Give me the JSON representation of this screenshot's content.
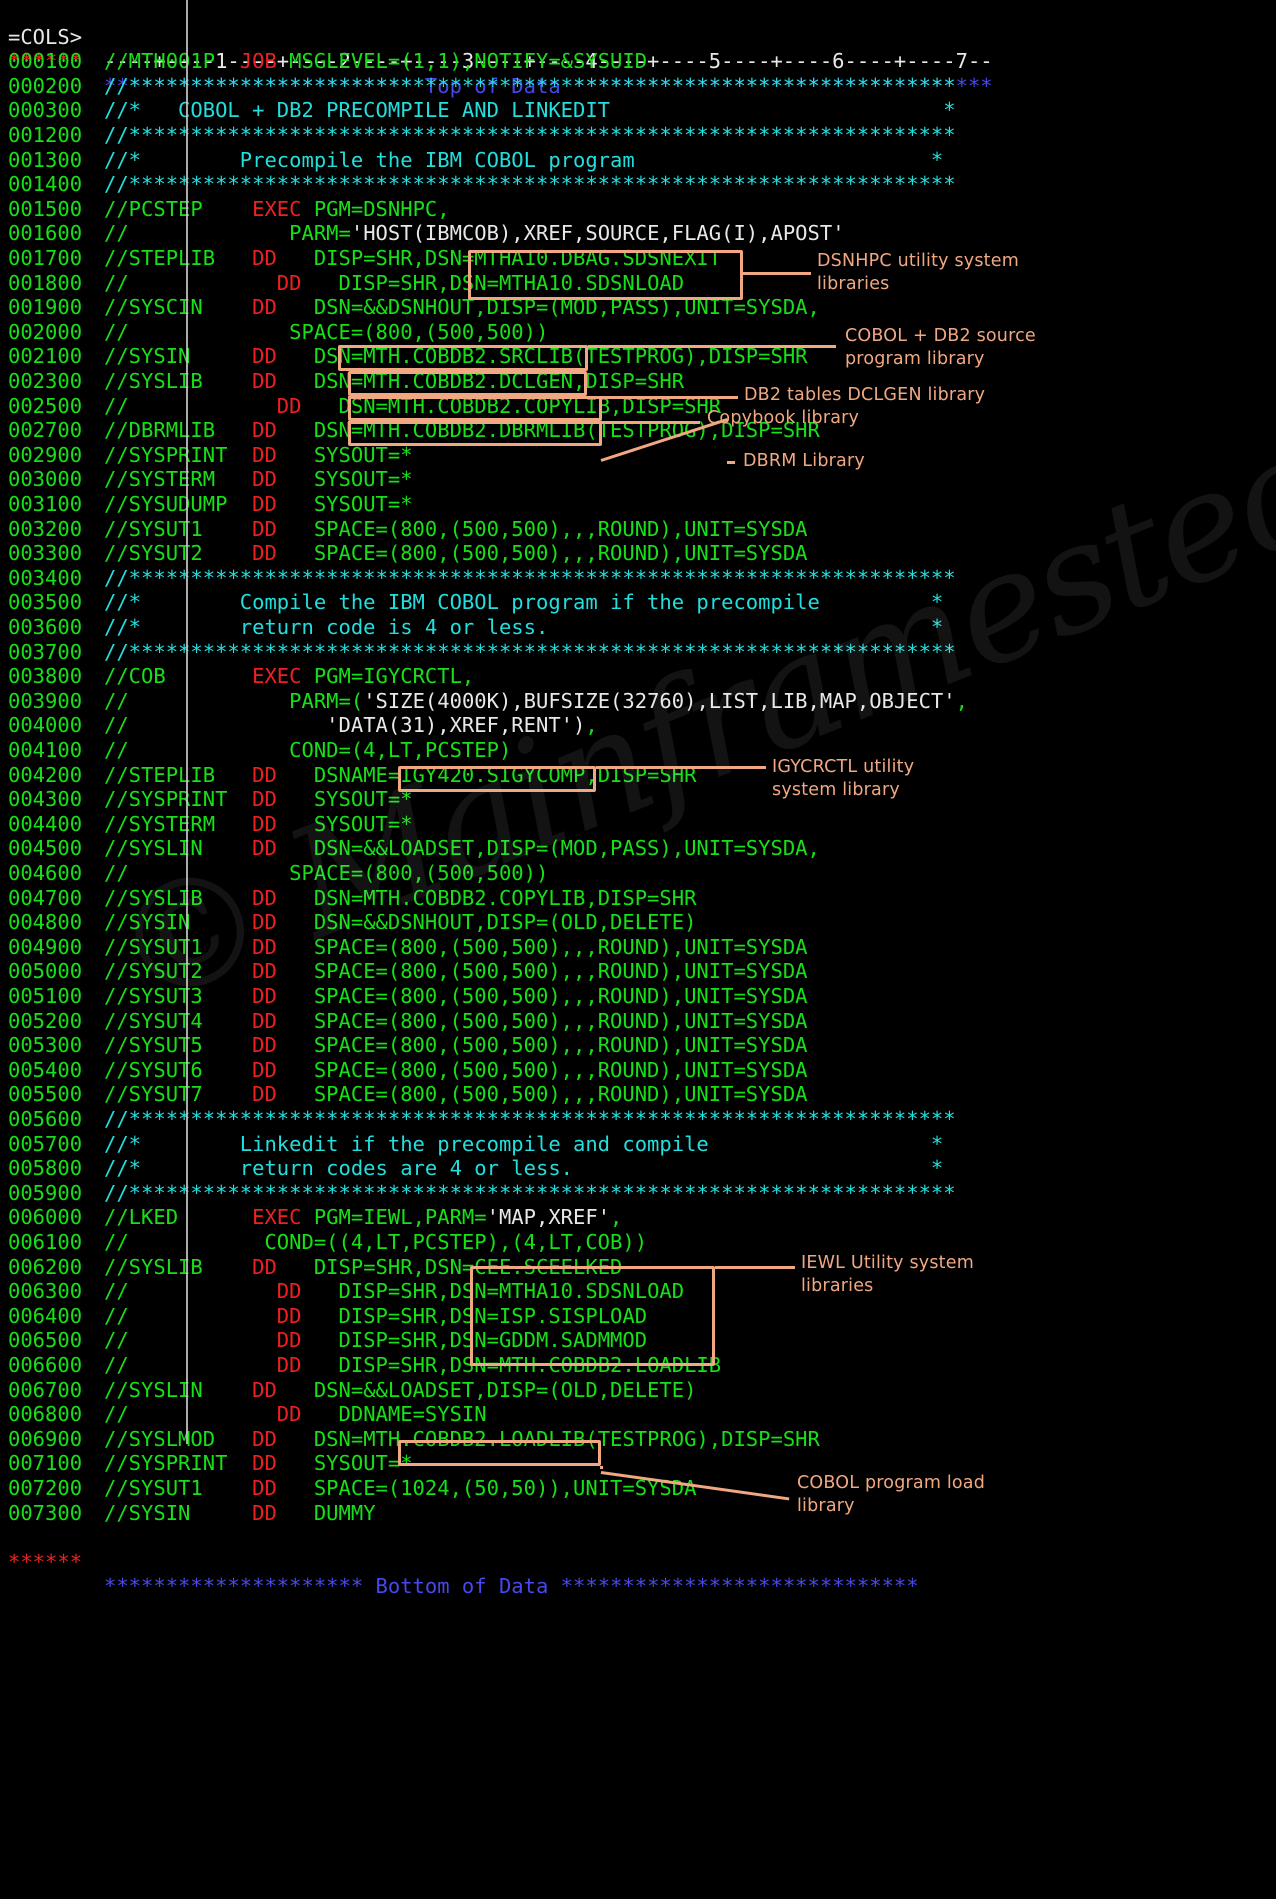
{
  "screen": {
    "kind": "ispf-editor",
    "colors": {
      "background": "#000000",
      "green": "#18e018",
      "red": "#ef2020",
      "cyan": "#24dede",
      "white": "#e8e8e8",
      "blue": "#4747ee",
      "annotation": "#f0a882"
    },
    "watermark": "© Mainframestechhelp"
  },
  "ruler": {
    "label": "=COLS>",
    "scale": "----+----1----+----2----+----3----+----4----+----5----+----6----+----7--"
  },
  "top_marker": {
    "number": "******",
    "stars_left": "*************************",
    "label": "Top of Data",
    "stars_right": "**********************************"
  },
  "bottom_marker": {
    "number": "******",
    "stars_left": "*********************",
    "label": "Bottom of Data",
    "stars_right": "*****************************"
  },
  "lines": [
    {
      "num": "000100",
      "segs": [
        {
          "t": "//MTH001P  ",
          "c": "green"
        },
        {
          "t": "JOB ",
          "c": "red"
        },
        {
          "t": "MSGLEVEL=(1,1),NOTIFY=&SYSUID",
          "c": "green"
        }
      ]
    },
    {
      "num": "000200",
      "segs": [
        {
          "t": "//*******************************************************************",
          "c": "cyan"
        }
      ]
    },
    {
      "num": "000300",
      "segs": [
        {
          "t": "//*   COBOL + DB2 PRECOMPILE AND LINKEDIT                           *",
          "c": "cyan"
        }
      ]
    },
    {
      "num": "001200",
      "segs": [
        {
          "t": "//*******************************************************************",
          "c": "cyan"
        }
      ]
    },
    {
      "num": "001300",
      "segs": [
        {
          "t": "//*        Precompile the IBM COBOL program                        *",
          "c": "cyan"
        }
      ]
    },
    {
      "num": "001400",
      "segs": [
        {
          "t": "//*******************************************************************",
          "c": "cyan"
        }
      ]
    },
    {
      "num": "001500",
      "segs": [
        {
          "t": "//PCSTEP    ",
          "c": "green"
        },
        {
          "t": "EXEC ",
          "c": "red"
        },
        {
          "t": "PGM=DSNHPC,",
          "c": "green"
        }
      ]
    },
    {
      "num": "001600",
      "segs": [
        {
          "t": "//             ",
          "c": "green"
        },
        {
          "t": "PARM=",
          "c": "green"
        },
        {
          "t": "'HOST(IBMCOB),XREF,SOURCE,FLAG(I),APOST'",
          "c": "white"
        }
      ]
    },
    {
      "num": "001700",
      "segs": [
        {
          "t": "//STEPLIB   ",
          "c": "green"
        },
        {
          "t": "DD ",
          "c": "red"
        },
        {
          "t": "  DISP=SHR,DSN=MTHA10.DBAG.SDSNEXIT",
          "c": "green"
        }
      ]
    },
    {
      "num": "001800",
      "segs": [
        {
          "t": "//         ",
          "c": "green"
        },
        {
          "t": "   DD ",
          "c": "red"
        },
        {
          "t": "  DISP=SHR,DSN=MTHA10.SDSNLOAD",
          "c": "green"
        }
      ]
    },
    {
      "num": "001900",
      "segs": [
        {
          "t": "//SYSCIN    ",
          "c": "green"
        },
        {
          "t": "DD ",
          "c": "red"
        },
        {
          "t": "  DSN=&&DSNHOUT,DISP=(MOD,PASS),UNIT=SYSDA,",
          "c": "green"
        }
      ]
    },
    {
      "num": "002000",
      "segs": [
        {
          "t": "//             SPACE=(800,(500,500))",
          "c": "green"
        }
      ]
    },
    {
      "num": "002100",
      "segs": [
        {
          "t": "//SYSIN     ",
          "c": "green"
        },
        {
          "t": "DD ",
          "c": "red"
        },
        {
          "t": "  DSN=MTH.COBDB2.SRCLIB(TESTPROG),DISP=SHR",
          "c": "green"
        }
      ]
    },
    {
      "num": "002300",
      "segs": [
        {
          "t": "//SYSLIB    ",
          "c": "green"
        },
        {
          "t": "DD ",
          "c": "red"
        },
        {
          "t": "  DSN=MTH.COBDB2.DCLGEN,DISP=SHR",
          "c": "green"
        }
      ]
    },
    {
      "num": "002500",
      "segs": [
        {
          "t": "//         ",
          "c": "green"
        },
        {
          "t": "   DD ",
          "c": "red"
        },
        {
          "t": "  DSN=MTH.COBDB2.COPYLIB,DISP=SHR",
          "c": "green"
        }
      ]
    },
    {
      "num": "002700",
      "segs": [
        {
          "t": "//DBRMLIB   ",
          "c": "green"
        },
        {
          "t": "DD ",
          "c": "red"
        },
        {
          "t": "  DSN=MTH.COBDB2.DBRMLIB(TESTPROG),DISP=SHR",
          "c": "green"
        }
      ]
    },
    {
      "num": "002900",
      "segs": [
        {
          "t": "//SYSPRINT  ",
          "c": "green"
        },
        {
          "t": "DD ",
          "c": "red"
        },
        {
          "t": "  SYSOUT=*",
          "c": "green"
        }
      ]
    },
    {
      "num": "003000",
      "segs": [
        {
          "t": "//SYSTERM   ",
          "c": "green"
        },
        {
          "t": "DD ",
          "c": "red"
        },
        {
          "t": "  SYSOUT=*",
          "c": "green"
        }
      ]
    },
    {
      "num": "003100",
      "segs": [
        {
          "t": "//SYSUDUMP  ",
          "c": "green"
        },
        {
          "t": "DD ",
          "c": "red"
        },
        {
          "t": "  SYSOUT=*",
          "c": "green"
        }
      ]
    },
    {
      "num": "003200",
      "segs": [
        {
          "t": "//SYSUT1    ",
          "c": "green"
        },
        {
          "t": "DD ",
          "c": "red"
        },
        {
          "t": "  SPACE=(800,(500,500),,,ROUND),UNIT=SYSDA",
          "c": "green"
        }
      ]
    },
    {
      "num": "003300",
      "segs": [
        {
          "t": "//SYSUT2    ",
          "c": "green"
        },
        {
          "t": "DD ",
          "c": "red"
        },
        {
          "t": "  SPACE=(800,(500,500),,,ROUND),UNIT=SYSDA",
          "c": "green"
        }
      ]
    },
    {
      "num": "003400",
      "segs": [
        {
          "t": "//*******************************************************************",
          "c": "cyan"
        }
      ]
    },
    {
      "num": "003500",
      "segs": [
        {
          "t": "//*        Compile the IBM COBOL program if the precompile         *",
          "c": "cyan"
        }
      ]
    },
    {
      "num": "003600",
      "segs": [
        {
          "t": "//*        return code is 4 or less.                               *",
          "c": "cyan"
        }
      ]
    },
    {
      "num": "003700",
      "segs": [
        {
          "t": "//*******************************************************************",
          "c": "cyan"
        }
      ]
    },
    {
      "num": "003800",
      "segs": [
        {
          "t": "//COB       ",
          "c": "green"
        },
        {
          "t": "EXEC ",
          "c": "red"
        },
        {
          "t": "PGM=IGYCRCTL,",
          "c": "green"
        }
      ]
    },
    {
      "num": "003900",
      "segs": [
        {
          "t": "//             ",
          "c": "green"
        },
        {
          "t": "PARM=(",
          "c": "green"
        },
        {
          "t": "'SIZE(4000K),BUFSIZE(32760),LIST,LIB,MAP,OBJECT'",
          "c": "white"
        },
        {
          "t": ",",
          "c": "green"
        }
      ]
    },
    {
      "num": "004000",
      "segs": [
        {
          "t": "//                ",
          "c": "green"
        },
        {
          "t": "'DATA(31),XREF,RENT')",
          "c": "white"
        },
        {
          "t": ",",
          "c": "green"
        }
      ]
    },
    {
      "num": "004100",
      "segs": [
        {
          "t": "//             COND=(4,LT,PCSTEP)",
          "c": "green"
        }
      ]
    },
    {
      "num": "004200",
      "segs": [
        {
          "t": "//STEPLIB   ",
          "c": "green"
        },
        {
          "t": "DD ",
          "c": "red"
        },
        {
          "t": "  DSNAME=IGY420.SIGYCOMP,DISP=SHR",
          "c": "green"
        }
      ]
    },
    {
      "num": "004300",
      "segs": [
        {
          "t": "//SYSPRINT  ",
          "c": "green"
        },
        {
          "t": "DD ",
          "c": "red"
        },
        {
          "t": "  SYSOUT=*",
          "c": "green"
        }
      ]
    },
    {
      "num": "004400",
      "segs": [
        {
          "t": "//SYSTERM   ",
          "c": "green"
        },
        {
          "t": "DD ",
          "c": "red"
        },
        {
          "t": "  SYSOUT=*",
          "c": "green"
        }
      ]
    },
    {
      "num": "004500",
      "segs": [
        {
          "t": "//SYSLIN    ",
          "c": "green"
        },
        {
          "t": "DD ",
          "c": "red"
        },
        {
          "t": "  DSN=&&LOADSET,DISP=(MOD,PASS),UNIT=SYSDA,",
          "c": "green"
        }
      ]
    },
    {
      "num": "004600",
      "segs": [
        {
          "t": "//             SPACE=(800,(500,500))",
          "c": "green"
        }
      ]
    },
    {
      "num": "004700",
      "segs": [
        {
          "t": "//SYSLIB    ",
          "c": "green"
        },
        {
          "t": "DD ",
          "c": "red"
        },
        {
          "t": "  DSN=MTH.COBDB2.COPYLIB,DISP=SHR",
          "c": "green"
        }
      ]
    },
    {
      "num": "004800",
      "segs": [
        {
          "t": "//SYSIN     ",
          "c": "green"
        },
        {
          "t": "DD ",
          "c": "red"
        },
        {
          "t": "  DSN=&&DSNHOUT,DISP=(OLD,DELETE)",
          "c": "green"
        }
      ]
    },
    {
      "num": "004900",
      "segs": [
        {
          "t": "//SYSUT1    ",
          "c": "green"
        },
        {
          "t": "DD ",
          "c": "red"
        },
        {
          "t": "  SPACE=(800,(500,500),,,ROUND),UNIT=SYSDA",
          "c": "green"
        }
      ]
    },
    {
      "num": "005000",
      "segs": [
        {
          "t": "//SYSUT2    ",
          "c": "green"
        },
        {
          "t": "DD ",
          "c": "red"
        },
        {
          "t": "  SPACE=(800,(500,500),,,ROUND),UNIT=SYSDA",
          "c": "green"
        }
      ]
    },
    {
      "num": "005100",
      "segs": [
        {
          "t": "//SYSUT3    ",
          "c": "green"
        },
        {
          "t": "DD ",
          "c": "red"
        },
        {
          "t": "  SPACE=(800,(500,500),,,ROUND),UNIT=SYSDA",
          "c": "green"
        }
      ]
    },
    {
      "num": "005200",
      "segs": [
        {
          "t": "//SYSUT4    ",
          "c": "green"
        },
        {
          "t": "DD ",
          "c": "red"
        },
        {
          "t": "  SPACE=(800,(500,500),,,ROUND),UNIT=SYSDA",
          "c": "green"
        }
      ]
    },
    {
      "num": "005300",
      "segs": [
        {
          "t": "//SYSUT5    ",
          "c": "green"
        },
        {
          "t": "DD ",
          "c": "red"
        },
        {
          "t": "  SPACE=(800,(500,500),,,ROUND),UNIT=SYSDA",
          "c": "green"
        }
      ]
    },
    {
      "num": "005400",
      "segs": [
        {
          "t": "//SYSUT6    ",
          "c": "green"
        },
        {
          "t": "DD ",
          "c": "red"
        },
        {
          "t": "  SPACE=(800,(500,500),,,ROUND),UNIT=SYSDA",
          "c": "green"
        }
      ]
    },
    {
      "num": "005500",
      "segs": [
        {
          "t": "//SYSUT7    ",
          "c": "green"
        },
        {
          "t": "DD ",
          "c": "red"
        },
        {
          "t": "  SPACE=(800,(500,500),,,ROUND),UNIT=SYSDA",
          "c": "green"
        }
      ]
    },
    {
      "num": "005600",
      "segs": [
        {
          "t": "//*******************************************************************",
          "c": "cyan"
        }
      ]
    },
    {
      "num": "005700",
      "segs": [
        {
          "t": "//*        Linkedit if the precompile and compile                  *",
          "c": "cyan"
        }
      ]
    },
    {
      "num": "005800",
      "segs": [
        {
          "t": "//*        return codes are 4 or less.                             *",
          "c": "cyan"
        }
      ]
    },
    {
      "num": "005900",
      "segs": [
        {
          "t": "//*******************************************************************",
          "c": "cyan"
        }
      ]
    },
    {
      "num": "006000",
      "segs": [
        {
          "t": "//LKED      ",
          "c": "green"
        },
        {
          "t": "EXEC ",
          "c": "red"
        },
        {
          "t": "PGM=IEWL,PARM=",
          "c": "green"
        },
        {
          "t": "'MAP,XREF'",
          "c": "white"
        },
        {
          "t": ",",
          "c": "green"
        }
      ]
    },
    {
      "num": "006100",
      "segs": [
        {
          "t": "//           COND=((4,LT,PCSTEP),(4,LT,COB))",
          "c": "green"
        }
      ]
    },
    {
      "num": "006200",
      "segs": [
        {
          "t": "//SYSLIB    ",
          "c": "green"
        },
        {
          "t": "DD ",
          "c": "red"
        },
        {
          "t": "  DISP=SHR,DSN=CEE.SCEELKED",
          "c": "green"
        }
      ]
    },
    {
      "num": "006300",
      "segs": [
        {
          "t": "//         ",
          "c": "green"
        },
        {
          "t": "   DD ",
          "c": "red"
        },
        {
          "t": "  DISP=SHR,DSN=MTHA10.SDSNLOAD",
          "c": "green"
        }
      ]
    },
    {
      "num": "006400",
      "segs": [
        {
          "t": "//         ",
          "c": "green"
        },
        {
          "t": "   DD ",
          "c": "red"
        },
        {
          "t": "  DISP=SHR,DSN=ISP.SISPLOAD",
          "c": "green"
        }
      ]
    },
    {
      "num": "006500",
      "segs": [
        {
          "t": "//         ",
          "c": "green"
        },
        {
          "t": "   DD ",
          "c": "red"
        },
        {
          "t": "  DISP=SHR,DSN=GDDM.SADMMOD",
          "c": "green"
        }
      ]
    },
    {
      "num": "006600",
      "segs": [
        {
          "t": "//         ",
          "c": "green"
        },
        {
          "t": "   DD ",
          "c": "red"
        },
        {
          "t": "  DISP=SHR,DSN=MTH.COBDB2.LOADLIB",
          "c": "green"
        }
      ]
    },
    {
      "num": "006700",
      "segs": [
        {
          "t": "//SYSLIN    ",
          "c": "green"
        },
        {
          "t": "DD ",
          "c": "red"
        },
        {
          "t": "  DSN=&&LOADSET,DISP=(OLD,DELETE)",
          "c": "green"
        }
      ]
    },
    {
      "num": "006800",
      "segs": [
        {
          "t": "//         ",
          "c": "green"
        },
        {
          "t": "   DD ",
          "c": "red"
        },
        {
          "t": "  DDNAME=SYSIN",
          "c": "green"
        }
      ]
    },
    {
      "num": "006900",
      "segs": [
        {
          "t": "//SYSLMOD   ",
          "c": "green"
        },
        {
          "t": "DD ",
          "c": "red"
        },
        {
          "t": "  DSN=MTH.COBDB2.LOADLIB(TESTPROG),DISP=SHR",
          "c": "green"
        }
      ]
    },
    {
      "num": "007100",
      "segs": [
        {
          "t": "//SYSPRINT  ",
          "c": "green"
        },
        {
          "t": "DD ",
          "c": "red"
        },
        {
          "t": "  SYSOUT=*",
          "c": "green"
        }
      ]
    },
    {
      "num": "007200",
      "segs": [
        {
          "t": "//SYSUT1    ",
          "c": "green"
        },
        {
          "t": "DD ",
          "c": "red"
        },
        {
          "t": "  SPACE=(1024,(50,50)),UNIT=SYSDA",
          "c": "green"
        }
      ]
    },
    {
      "num": "007300",
      "segs": [
        {
          "t": "//SYSIN     ",
          "c": "green"
        },
        {
          "t": "DD ",
          "c": "red"
        },
        {
          "t": "  DUMMY",
          "c": "green"
        }
      ]
    }
  ],
  "annotations": [
    {
      "id": "dsnhpc",
      "text": "DSNHPC utility system\nlibraries"
    },
    {
      "id": "srclib",
      "text": "COBOL + DB2 source\nprogram library"
    },
    {
      "id": "dclgen",
      "text": "DB2 tables DCLGEN library"
    },
    {
      "id": "copylib",
      "text": "Copybook library"
    },
    {
      "id": "dbrmlib",
      "text": "DBRM Library"
    },
    {
      "id": "igycrctl",
      "text": "IGYCRCTL utility\nsystem library"
    },
    {
      "id": "iewl",
      "text": "IEWL Utility system\nlibraries"
    },
    {
      "id": "loadlib",
      "text": "COBOL program load\nlibrary"
    }
  ]
}
